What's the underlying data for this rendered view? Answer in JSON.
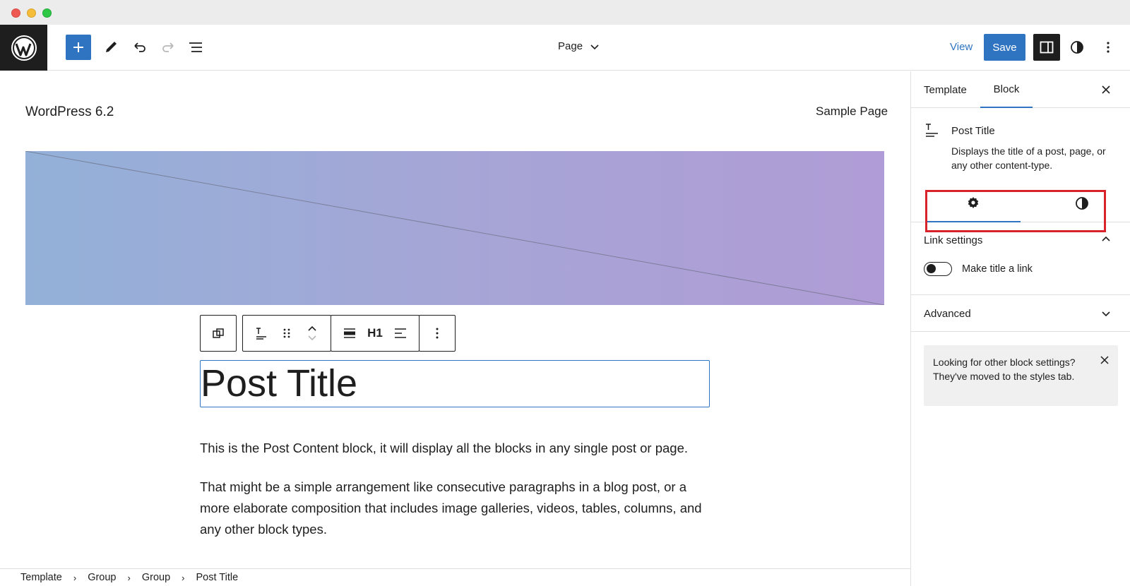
{
  "toolbar": {
    "page_label": "Page",
    "view_label": "View",
    "save_label": "Save"
  },
  "canvas": {
    "site_title": "WordPress 6.2",
    "nav_link": "Sample Page",
    "heading_level": "H1",
    "post_title": "Post Title",
    "paragraph_1": "This is the Post Content block, it will display all the blocks in any single post or page.",
    "paragraph_2": "That might be a simple arrangement like consecutive paragraphs in a blog post, or a more elaborate composition that includes image galleries, videos, tables, columns, and any other block types."
  },
  "breadcrumb": [
    "Template",
    "Group",
    "Group",
    "Post Title"
  ],
  "sidebar": {
    "tabs": [
      "Template",
      "Block"
    ],
    "active_tab": "Block",
    "block_name": "Post Title",
    "block_description": "Displays the title of a post, page, or any other content-type.",
    "link_settings_title": "Link settings",
    "toggle_label": "Make title a link",
    "toggle_on": false,
    "advanced_title": "Advanced",
    "notice_text": "Looking for other block settings? They've moved to the styles tab."
  },
  "colors": {
    "accent": "#2f74c0",
    "highlight": "#d9232b",
    "cover_start": "#93b1d8",
    "cover_end": "#b09cd6"
  },
  "icons": [
    "wordpress-logo-icon",
    "plus-icon",
    "pencil-icon",
    "undo-icon",
    "redo-icon",
    "list-view-icon",
    "chevron-down-icon",
    "sidebar-icon",
    "contrast-icon",
    "more-vertical-icon",
    "close-icon",
    "post-title-icon",
    "gear-icon",
    "chevron-up-icon"
  ]
}
